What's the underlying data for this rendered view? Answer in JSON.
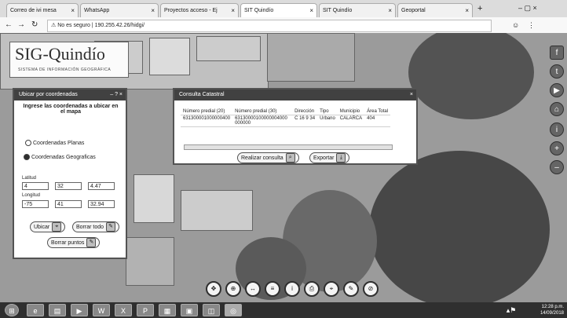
{
  "browser": {
    "tabs": [
      {
        "label": "Correo de ivi mesa"
      },
      {
        "label": "WhatsApp"
      },
      {
        "label": "Proyectos acceso - Ej"
      },
      {
        "label": "SIT Quindío"
      },
      {
        "label": "SIT Quindío"
      },
      {
        "label": "Geoportal"
      }
    ],
    "url_prefix": "No es seguro",
    "url": "190.255.42.26/hidgi/"
  },
  "logo": {
    "title": "SIG-Quindío",
    "subtitle": "SISTEMA DE INFORMACIÓN GEOGRÁFICA"
  },
  "left_panel": {
    "title": "Ubicar por coordenadas",
    "instructions": "Ingrese las coordenadas a ubicar en el mapa",
    "option_manual": "Coordenadas Planas",
    "option_geo": "Coordenadas Geograficas",
    "latitude_label": "Latitud",
    "lat_deg": "4",
    "lat_min": "32",
    "lat_sec": "4.47",
    "longitude_label": "Longitud",
    "lon_deg": "-75",
    "lon_min": "41",
    "lon_sec": "32.94",
    "locate_button": "Ubicar",
    "clear_button": "Borrar todo",
    "clear_points_button": "Borrar puntos"
  },
  "dialog": {
    "title": "Consulta Catastral",
    "columns": [
      "Número predial (20)",
      "Número predial (30)",
      "Dirección",
      "Tipo",
      "Municipio",
      "Área Total"
    ],
    "rows": [
      [
        "631300001000000400",
        "63130000100000004000000000",
        "C 16 9 34",
        "Urbano",
        "CALARCA",
        "404"
      ]
    ],
    "new_query_button": "Realizar consulta",
    "export_button": "Exportar"
  },
  "taskbar": {
    "time": "12:28 p.m.",
    "date": "14/09/2018"
  }
}
